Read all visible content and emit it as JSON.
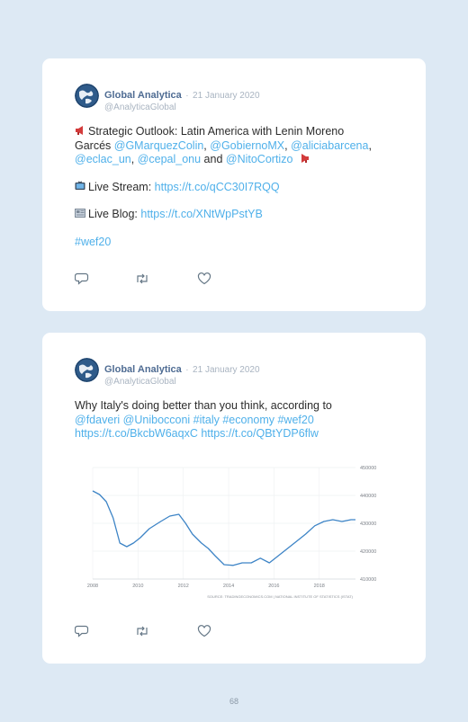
{
  "posts": [
    {
      "author": "Global Analytica",
      "separator": "·",
      "date": "21 January 2020",
      "handle": "@AnalyticaGlobal",
      "line1_text": "Strategic Outlook: Latin America with Lenin Moreno",
      "line2_start": "Garcés ",
      "mention1": "@GMarquezColin",
      "comma1": ", ",
      "mention2": "@GobiernoMX",
      "comma2": ", ",
      "mention3": "@aliciabarcena",
      "comma3": ",",
      "mention4": "@eclac_un",
      "comma4": ", ",
      "mention5": "@cepal_onu",
      "and": " and ",
      "mention6": "@NitoCortizo",
      "stream_label": "Live Stream: ",
      "stream_url": "https://t.co/qCC30I7RQQ",
      "blog_label": "Live Blog: ",
      "blog_url": "https://t.co/XNtWpPstYB",
      "hashtag": "#wef20",
      "icons": {
        "reply": "reply-icon",
        "retweet": "retweet-icon",
        "like": "heart-icon",
        "megaphone": "megaphone-icon",
        "tv": "tv-icon",
        "newspaper": "newspaper-icon"
      }
    },
    {
      "author": "Global Analytica",
      "separator": "·",
      "date": "21 January 2020",
      "handle": "@AnalyticaGlobal",
      "line1_text": "Why Italy's doing better than you think, according to",
      "line2": "@fdaveri @Unibocconi #italy #economy #wef20",
      "line3": "https://t.co/BkcbW6aqxC https://t.co/QBtYDP6flw",
      "icons": {
        "reply": "reply-icon",
        "retweet": "retweet-icon",
        "like": "heart-icon"
      }
    }
  ],
  "chart_data": {
    "type": "line",
    "x": [
      2008.0,
      2008.3,
      2008.6,
      2008.9,
      2009.2,
      2009.5,
      2009.8,
      2010.1,
      2010.5,
      2011.0,
      2011.4,
      2011.8,
      2012.1,
      2012.4,
      2012.8,
      2013.1,
      2013.4,
      2013.8,
      2014.2,
      2014.6,
      2015.0,
      2015.4,
      2015.8,
      2016.2,
      2016.6,
      2017.0,
      2017.4,
      2017.8,
      2018.2,
      2018.6,
      2019.0,
      2019.4,
      2019.6
    ],
    "y": [
      434500,
      433500,
      431500,
      427000,
      420000,
      419000,
      420000,
      421500,
      424000,
      426000,
      427500,
      428000,
      425500,
      422500,
      420000,
      418500,
      416500,
      414000,
      413800,
      414500,
      414500,
      415800,
      414500,
      416500,
      418500,
      420500,
      422500,
      424800,
      426000,
      426500,
      426000,
      426500,
      426500
    ],
    "ylim": [
      410000,
      441000
    ],
    "xlim": [
      2008,
      2019.6
    ],
    "x_ticks": [
      "2008",
      "2010",
      "2012",
      "2014",
      "2016",
      "2018"
    ],
    "y_ticks": [
      "450000",
      "440000",
      "430000",
      "420000",
      "410000"
    ],
    "source": "SOURCE: TRADINGECONOMICS.COM  |  NATIONAL INSTITUTE OF STATISTICS (ISTAT)",
    "line_color": "#3d84c6",
    "grid": true
  },
  "page_number": "68"
}
